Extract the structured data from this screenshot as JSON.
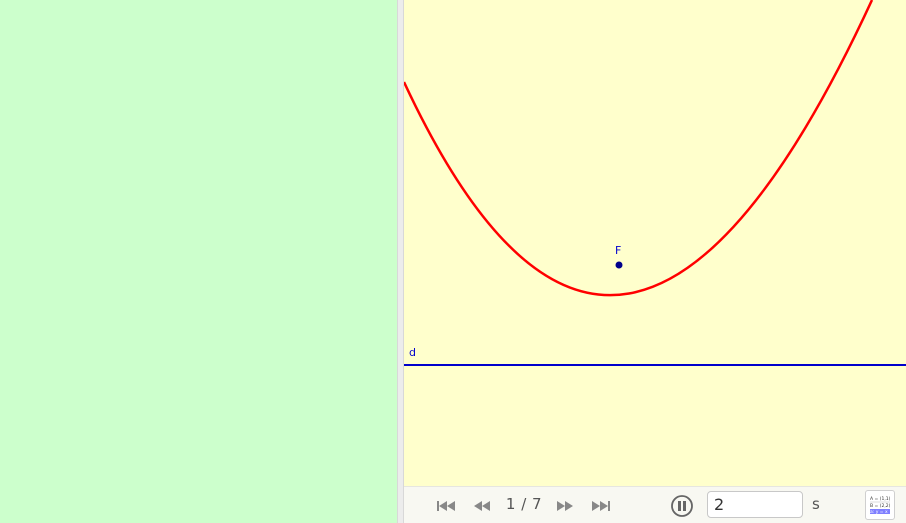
{
  "panels": {
    "left_background": "#ccffcc",
    "graphics_background": "#ffffcc"
  },
  "graphics": {
    "curve_color": "#ff0000",
    "line_color": "#0000cc",
    "point_color": "#00008b",
    "point_label": "F",
    "line_label": "d"
  },
  "toolbar": {
    "page_counter": "1 / 7",
    "speed_value": "2",
    "unit": "s",
    "buttons": {
      "first": "skip-to-start-icon",
      "previous": "rewind-icon",
      "next": "fast-forward-icon",
      "last": "skip-to-end-icon",
      "pause": "pause-icon",
      "algebra": "algebra-view-icon"
    }
  },
  "algebra_icon_text": {
    "line1": "A = (1,1)",
    "line2": "B = (2,2)",
    "line3": "a: y = x"
  }
}
